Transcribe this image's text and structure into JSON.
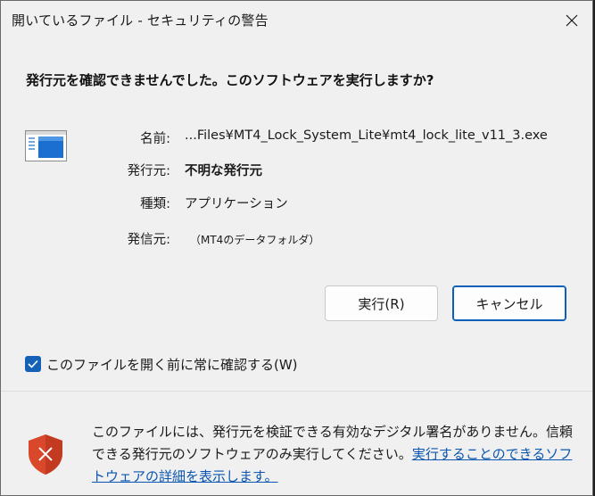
{
  "window": {
    "title": "開いているファイル - セキュリティの警告"
  },
  "dialog": {
    "question": "発行元を確認できませんでした。このソフトウェアを実行しますか?",
    "name_label": "名前:",
    "name_value": "...Files¥MT4_Lock_System_Lite¥mt4_lock_lite_v11_3.exe",
    "publisher_label": "発行元:",
    "publisher_value": "不明な発行元",
    "type_label": "種類:",
    "type_value": "アプリケーション",
    "from_label": "発信元:",
    "from_value": "（MT4のデータフォルダ）"
  },
  "buttons": {
    "run": "実行(R)",
    "cancel": "キャンセル"
  },
  "checkbox": {
    "label": "このファイルを開く前に常に確認する(W)",
    "checked": true
  },
  "footer": {
    "text": "このファイルには、発行元を検証できる有効なデジタル署名がありません。信頼できる発行元のソフトウェアのみ実行してください。",
    "link": "実行することのできるソフトウェアの詳細を表示します。"
  },
  "icons": {
    "close": "close-icon",
    "file": "application-file-icon",
    "shield": "warning-shield-icon",
    "checkmark": "checkmark-icon"
  },
  "colors": {
    "accent": "#1461b6",
    "link": "#0a56b0",
    "shield": "#d9482b"
  }
}
